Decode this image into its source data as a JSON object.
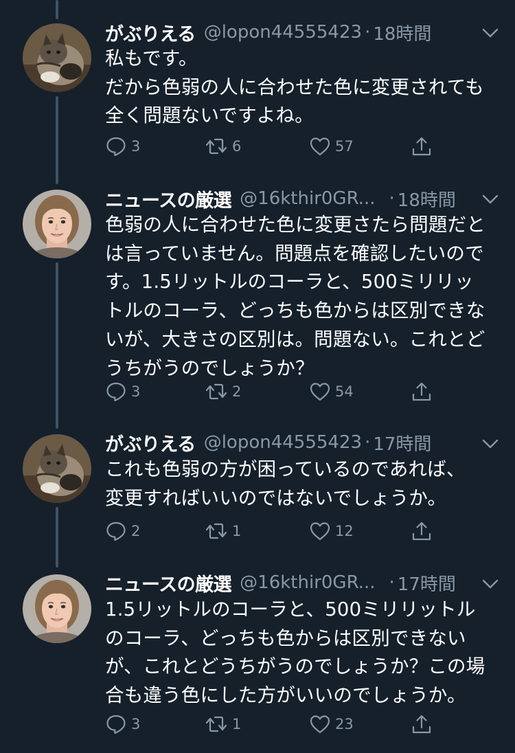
{
  "tweets": [
    {
      "name": "がぶりえる",
      "handle": "@lopon44555423",
      "separator": "·",
      "time": "18時間",
      "avatar": "cat-avatar",
      "lines": [
        "私もです。",
        "だから色弱の人に合わせた色に変更されても",
        "全く問題ないですよね。"
      ],
      "replies": "3",
      "retweets": "6",
      "likes": "57"
    },
    {
      "name": "ニュースの厳選",
      "handle": "@16kthir0GR...",
      "separator": "·",
      "time": "18時間",
      "avatar": "woman-avatar",
      "lines": [
        "色弱の人に合わせた色に変更さたら問題だと",
        "は言っていません。問題点を確認したいので",
        "す。1.5リットルのコーラと、500ミリリッ",
        "トルのコーラ、どっちも色からは区別できな",
        "いが、大きさの区別は。問題ない。これとど",
        "うちがうのでしょうか？"
      ],
      "replies": "3",
      "retweets": "2",
      "likes": "54"
    },
    {
      "name": "がぶりえる",
      "handle": "@lopon44555423",
      "separator": "·",
      "time": "17時間",
      "avatar": "cat-avatar",
      "lines": [
        "これも色弱の方が困っているのであれば、",
        "変更すればいいのではないでしょうか。"
      ],
      "replies": "2",
      "retweets": "1",
      "likes": "12"
    },
    {
      "name": "ニュースの厳選",
      "handle": "@16kthir0GR...",
      "separator": "·",
      "time": "17時間",
      "avatar": "woman-avatar",
      "lines": [
        "1.5リットルのコーラと、500ミリリットル",
        "のコーラ、どっちも色からは区別できない",
        "が、これとどうちがうのでしょうか？この場",
        "合も違う色にした方がいいのでしょうか。"
      ],
      "replies": "3",
      "retweets": "1",
      "likes": "23"
    }
  ],
  "colors": {
    "background": "#15202b",
    "text": "#ffffff",
    "secondary": "#8899a6",
    "thread_line": "#3d5466"
  }
}
